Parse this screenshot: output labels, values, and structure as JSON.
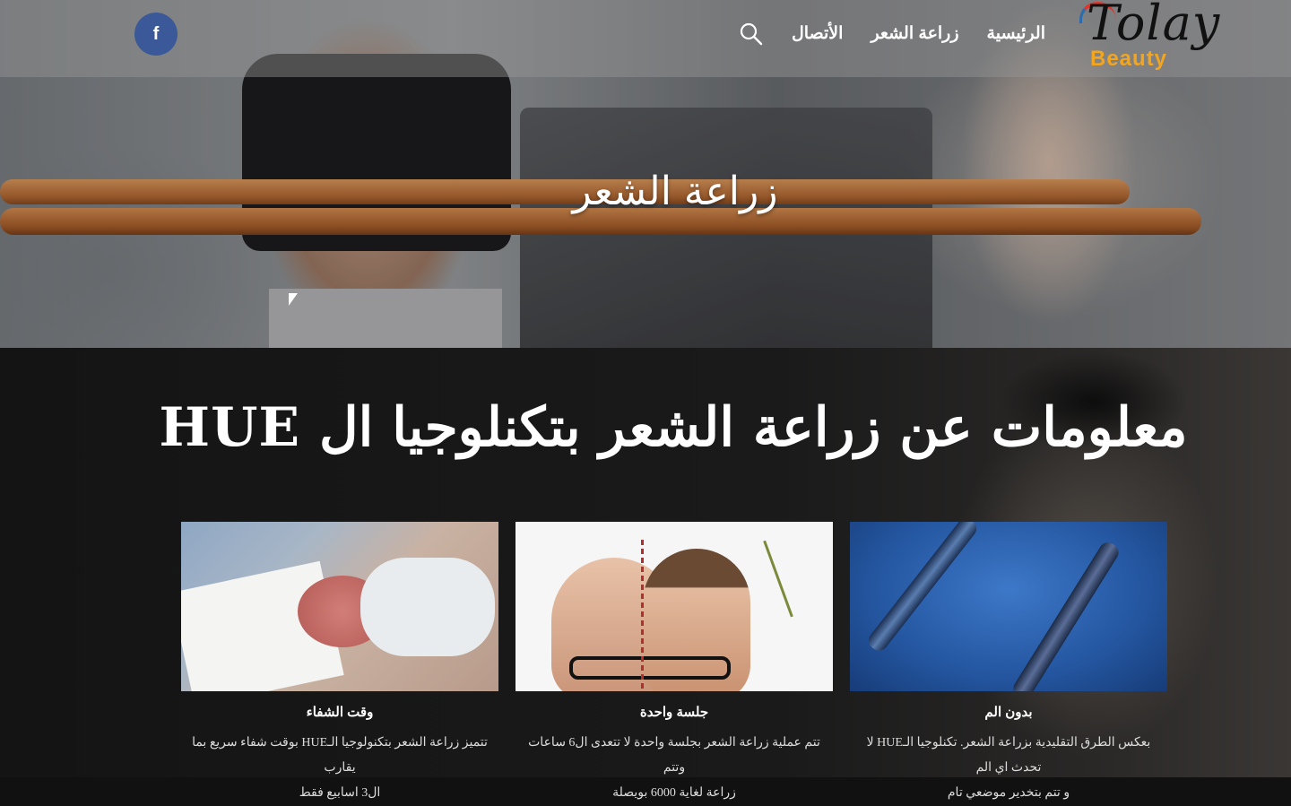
{
  "header": {
    "logo_text": "Tolay",
    "logo_sub": "Beauty",
    "nav": [
      {
        "label": "الرئيسية"
      },
      {
        "label": "زراعة الشعر"
      },
      {
        "label": "الأتصال"
      }
    ],
    "search_icon": "search-icon",
    "social": {
      "facebook_glyph": "f"
    }
  },
  "hero": {
    "title": "زراعة الشعر"
  },
  "info": {
    "title": "معلومات عن زراعة الشعر بتكنلوجيا ال HUE",
    "cards": [
      {
        "caption": "بدون الم",
        "desc_line1": "بعكس الطرق التقليدية بزراعة الشعر. تكنلوجيا الـHUE لا تحدث اي الم",
        "desc_line2": "و تتم بتخدير موضعي تام"
      },
      {
        "caption": "جلسة واحدة",
        "desc_line1": "تتم عملية زراعة الشعر بجلسة واحدة لا تتعدى ال6 ساعات وتتم",
        "desc_line2": "زراعة لغاية 6000 بويصلة"
      },
      {
        "caption": "وقت الشفاء",
        "desc_line1": "تتميز زراعة الشعر بتكنولوجيا الـHUE بوقت شفاء سريع بما يقارب",
        "desc_line2": "ال3 اسابيع فقط"
      }
    ]
  },
  "colors": {
    "facebook": "#3b5998",
    "logo_accent": "#f3a51d"
  }
}
